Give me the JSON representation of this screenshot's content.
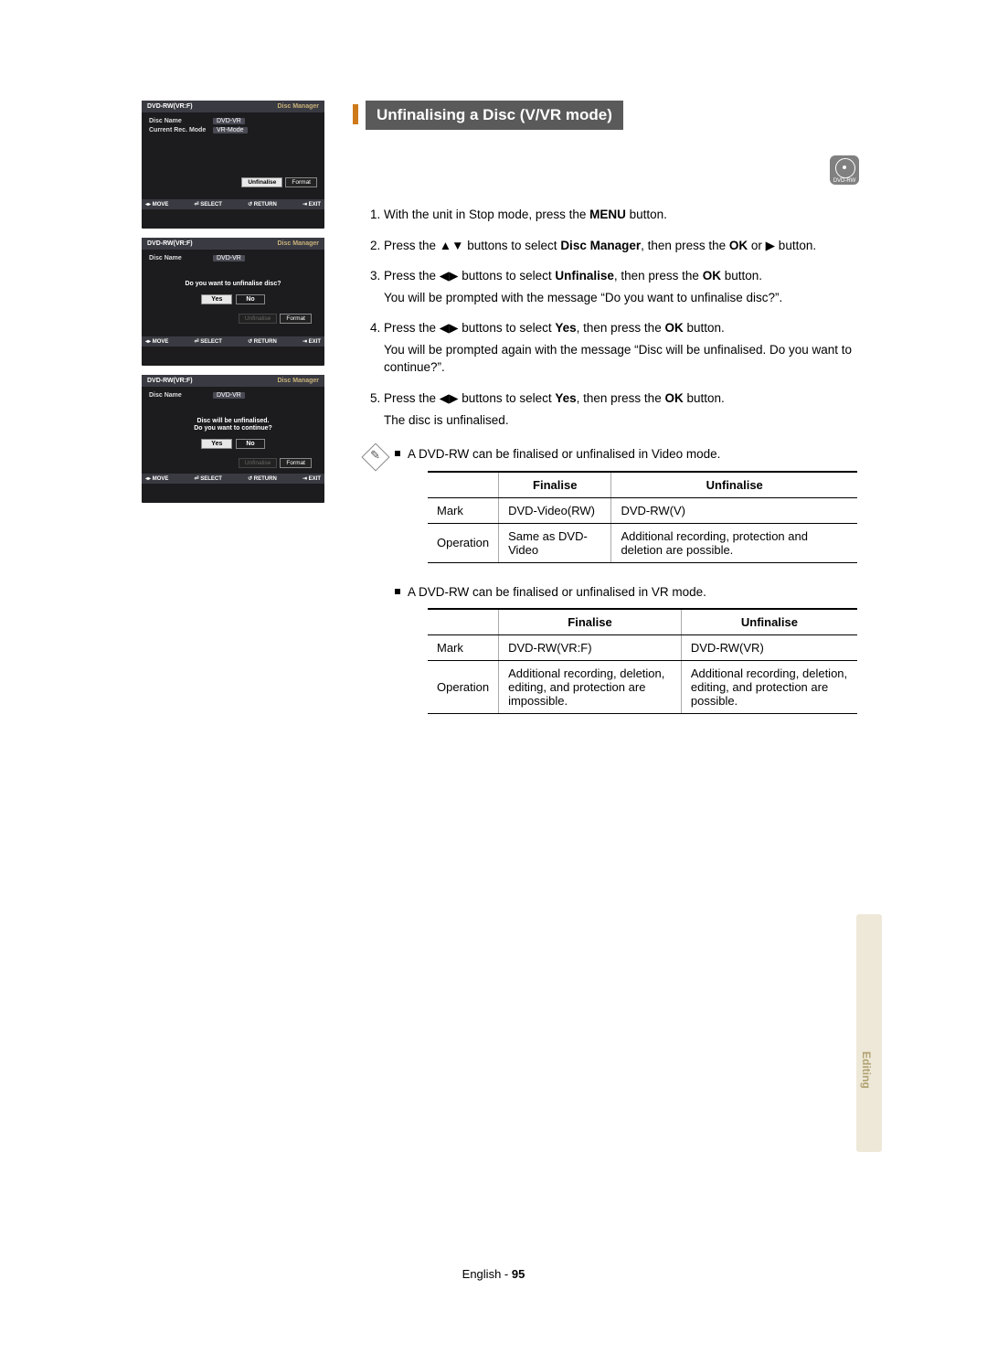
{
  "osd": {
    "panels": [
      {
        "titleLeft": "DVD-RW(VR:F)",
        "titleRight": "Disc Manager",
        "rows": [
          {
            "label": "Disc Name",
            "value": "DVD-VR"
          },
          {
            "label": "Current Rec. Mode",
            "value": "VR-Mode"
          }
        ],
        "buttons": [
          {
            "label": "Unfinalise",
            "selected": true
          },
          {
            "label": "Format",
            "selected": false
          }
        ]
      },
      {
        "titleLeft": "DVD-RW(VR:F)",
        "titleRight": "Disc Manager",
        "rows": [
          {
            "label": "Disc Name",
            "value": "DVD-VR"
          }
        ],
        "dialog": {
          "lines": [
            "Do you want to unfinalise disc?"
          ],
          "yes": "Yes",
          "no": "No",
          "yesSelected": true
        },
        "bottomButtons": [
          {
            "label": "Unfinalise",
            "inactive": true
          },
          {
            "label": "Format",
            "selected": false
          }
        ]
      },
      {
        "titleLeft": "DVD-RW(VR:F)",
        "titleRight": "Disc Manager",
        "rows": [
          {
            "label": "Disc Name",
            "value": "DVD-VR"
          }
        ],
        "dialog": {
          "lines": [
            "Disc will be unfinalised.",
            "Do you want to continue?"
          ],
          "yes": "Yes",
          "no": "No",
          "yesSelected": true
        },
        "bottomButtons": [
          {
            "label": "Unfinalise",
            "inactive": true
          },
          {
            "label": "Format",
            "selected": false
          }
        ]
      }
    ],
    "foot": {
      "move": "◂▸ MOVE",
      "select": "⏎ SELECT",
      "ret": "↺ RETURN",
      "exit": "⇥ EXIT"
    }
  },
  "section": {
    "title": "Unfinalising a Disc (V/VR mode)",
    "discLabel": "DVD-RW"
  },
  "steps": [
    {
      "text_html": "With the unit in Stop mode, press the <b>MENU</b> button."
    },
    {
      "text_html": "Press the ▲▼ buttons to select <b>Disc Manager</b>, then press the <b>OK</b> or ▶ button."
    },
    {
      "text_html": "Press the ◀▶ buttons to select <b>Unfinalise</b>, then press the <b>OK</b> button.",
      "sub": "You will be prompted with the message “Do you want to unfinalise disc?”."
    },
    {
      "text_html": "Press the ◀▶ buttons to select <b>Yes</b>, then press the <b>OK</b> button.",
      "sub": "You will be prompted again with the message “Disc will be unfinalised. Do you want to continue?”."
    },
    {
      "text_html": "Press the ◀▶ buttons to select <b>Yes</b>, then press the <b>OK</b> button.",
      "sub": "The disc is unfinalised."
    }
  ],
  "notes": {
    "bullets": [
      "A DVD-RW can be finalised or unfinalised in Video mode.",
      "A DVD-RW can be finalised or unfinalised in VR mode."
    ]
  },
  "tables": {
    "headers": {
      "col1": "",
      "col2": "Finalise",
      "col3": "Unfinalise"
    },
    "video": {
      "mark": {
        "label": "Mark",
        "finalise": "DVD-Video(RW)",
        "unfinalise": "DVD-RW(V)"
      },
      "op": {
        "label": "Operation",
        "finalise": "Same as DVD-Video",
        "unfinalise": "Additional recording, protection and deletion are possible."
      }
    },
    "vr": {
      "mark": {
        "label": "Mark",
        "finalise": "DVD-RW(VR:F)",
        "unfinalise": "DVD-RW(VR)"
      },
      "op": {
        "label": "Operation",
        "finalise": "Additional recording, deletion, editing, and protection are impossible.",
        "unfinalise": "Additional recording, deletion, editing, and protection are possible."
      }
    }
  },
  "footer": {
    "lang": "English",
    "sep": " - ",
    "page": "95"
  },
  "sideTab": "Editing"
}
